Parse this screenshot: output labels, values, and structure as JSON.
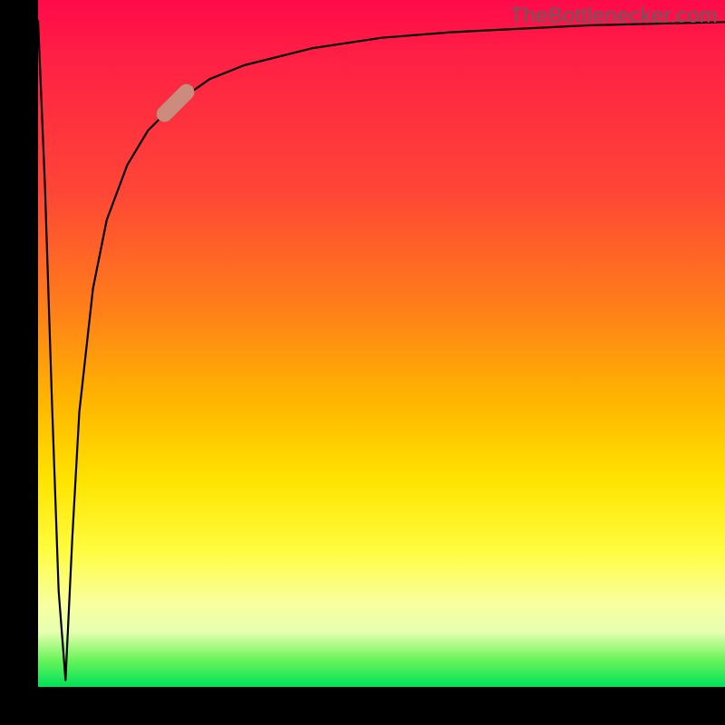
{
  "attribution": {
    "text": "TheBottlenecker.com"
  },
  "colors": {
    "axis": "#000000",
    "curve": "#000000",
    "marker": "#cc8c7d",
    "gradient_top": "#ff0a4a",
    "gradient_mid": "#ffe400",
    "gradient_bottom": "#00e05a"
  },
  "marker": {
    "x_pct": 0.2,
    "y_pct": 0.85
  },
  "chart_data": {
    "type": "line",
    "title": "",
    "xlabel": "",
    "ylabel": "",
    "xlim": [
      0,
      1
    ],
    "ylim": [
      0,
      1
    ],
    "legend": false,
    "grid": false,
    "annotations": [
      "TheBottlenecker.com"
    ],
    "series": [
      {
        "name": "curve",
        "x": [
          0.0,
          0.01,
          0.02,
          0.03,
          0.04,
          0.05,
          0.06,
          0.08,
          0.1,
          0.13,
          0.16,
          0.2,
          0.25,
          0.3,
          0.4,
          0.5,
          0.6,
          0.8,
          1.0
        ],
        "y": [
          0.97,
          0.73,
          0.42,
          0.14,
          0.01,
          0.22,
          0.4,
          0.58,
          0.68,
          0.76,
          0.81,
          0.85,
          0.885,
          0.905,
          0.93,
          0.945,
          0.953,
          0.963,
          0.968
        ]
      }
    ],
    "markers": [
      {
        "name": "highlight",
        "x": 0.2,
        "y": 0.85
      }
    ]
  }
}
